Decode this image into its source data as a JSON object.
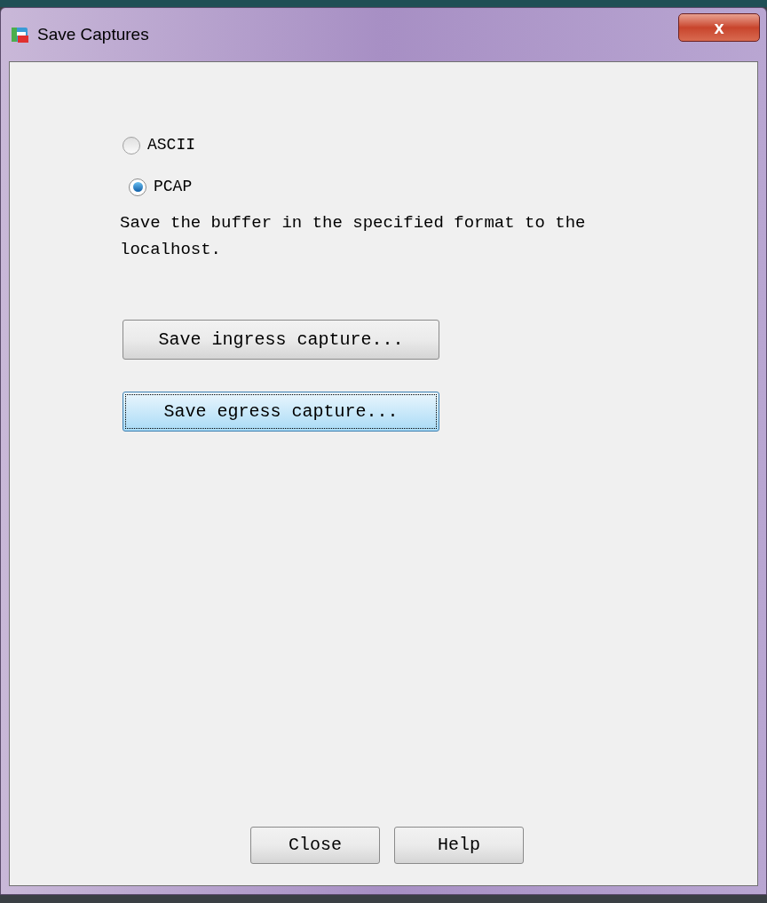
{
  "window": {
    "title": "Save Captures",
    "close_label": "x"
  },
  "format_options": [
    {
      "label": "ASCII",
      "selected": false
    },
    {
      "label": "PCAP",
      "selected": true
    }
  ],
  "description": "Save the buffer in the specified format to the localhost.",
  "capture_buttons": [
    {
      "label": "Save ingress capture...",
      "focused": false
    },
    {
      "label": "Save egress capture...",
      "focused": true
    }
  ],
  "footer_buttons": [
    {
      "label": "Close",
      "focused": false
    },
    {
      "label": "Help",
      "focused": false
    }
  ]
}
